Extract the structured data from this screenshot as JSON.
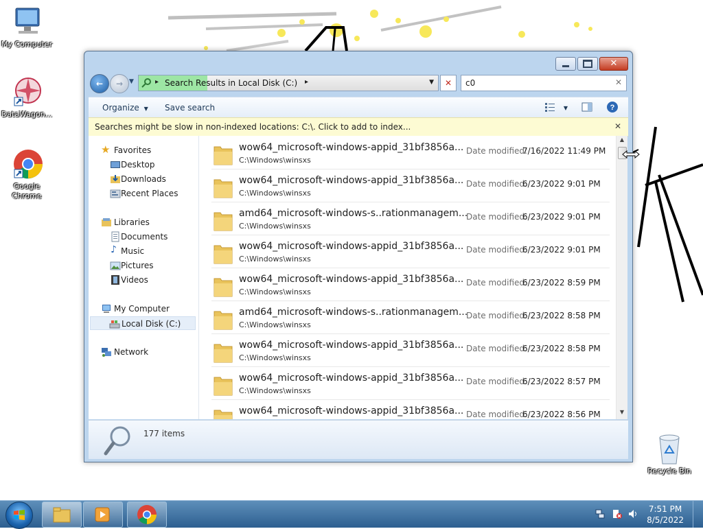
{
  "desktop": {
    "icons": [
      {
        "label": "My Computer",
        "icon": "computer-icon"
      },
      {
        "label": "DataWagon...",
        "icon": "datawagon-icon"
      },
      {
        "label": "Google Chrome",
        "icon": "chrome-icon"
      },
      {
        "label": "Recycle Bin",
        "icon": "recycle-bin-icon"
      }
    ]
  },
  "explorer": {
    "address": {
      "breadcrumb": "Search Results in Local Disk (C:)",
      "chevron": "▸"
    },
    "search": {
      "value": "c0"
    },
    "toolbar": {
      "organize": "Organize",
      "save_search": "Save search"
    },
    "infobar": {
      "message": "Searches might be slow in non-indexed locations: C:\\. Click to add to index..."
    },
    "nav": {
      "favorites": "Favorites",
      "desktop": "Desktop",
      "downloads": "Downloads",
      "recent": "Recent Places",
      "libraries": "Libraries",
      "documents": "Documents",
      "music": "Music",
      "pictures": "Pictures",
      "videos": "Videos",
      "my_computer": "My Computer",
      "local_disk": "Local Disk (C:)",
      "network": "Network"
    },
    "date_modified_label": "Date modified:",
    "results": [
      {
        "name": "wow64_microsoft-windows-appid_31bf3856a...",
        "path": "C:\\Windows\\winsxs",
        "date": "7/16/2022 11:49 PM"
      },
      {
        "name": "wow64_microsoft-windows-appid_31bf3856a...",
        "path": "C:\\Windows\\winsxs",
        "date": "6/23/2022 9:01 PM"
      },
      {
        "name": "amd64_microsoft-windows-s..rationmanagem...",
        "path": "C:\\Windows\\winsxs",
        "date": "6/23/2022 9:01 PM"
      },
      {
        "name": "wow64_microsoft-windows-appid_31bf3856a...",
        "path": "C:\\Windows\\winsxs",
        "date": "6/23/2022 9:01 PM"
      },
      {
        "name": "wow64_microsoft-windows-appid_31bf3856a...",
        "path": "C:\\Windows\\winsxs",
        "date": "6/23/2022 8:59 PM"
      },
      {
        "name": "amd64_microsoft-windows-s..rationmanagem...",
        "path": "C:\\Windows\\winsxs",
        "date": "6/23/2022 8:58 PM"
      },
      {
        "name": "wow64_microsoft-windows-appid_31bf3856a...",
        "path": "C:\\Windows\\winsxs",
        "date": "6/23/2022 8:58 PM"
      },
      {
        "name": "wow64_microsoft-windows-appid_31bf3856a...",
        "path": "C:\\Windows\\winsxs",
        "date": "6/23/2022 8:57 PM"
      },
      {
        "name": "wow64_microsoft-windows-appid_31bf3856a...",
        "path": "",
        "date": "6/23/2022 8:56 PM"
      }
    ],
    "status": {
      "item_count": "177 items"
    }
  },
  "taskbar": {
    "clock_time": "7:51 PM",
    "clock_date": "8/5/2022"
  },
  "colors": {
    "accent": "#2d5f90",
    "infobar": "#fdfbd3",
    "address_progress": "#85e08d",
    "close_button": "#c43c22"
  }
}
